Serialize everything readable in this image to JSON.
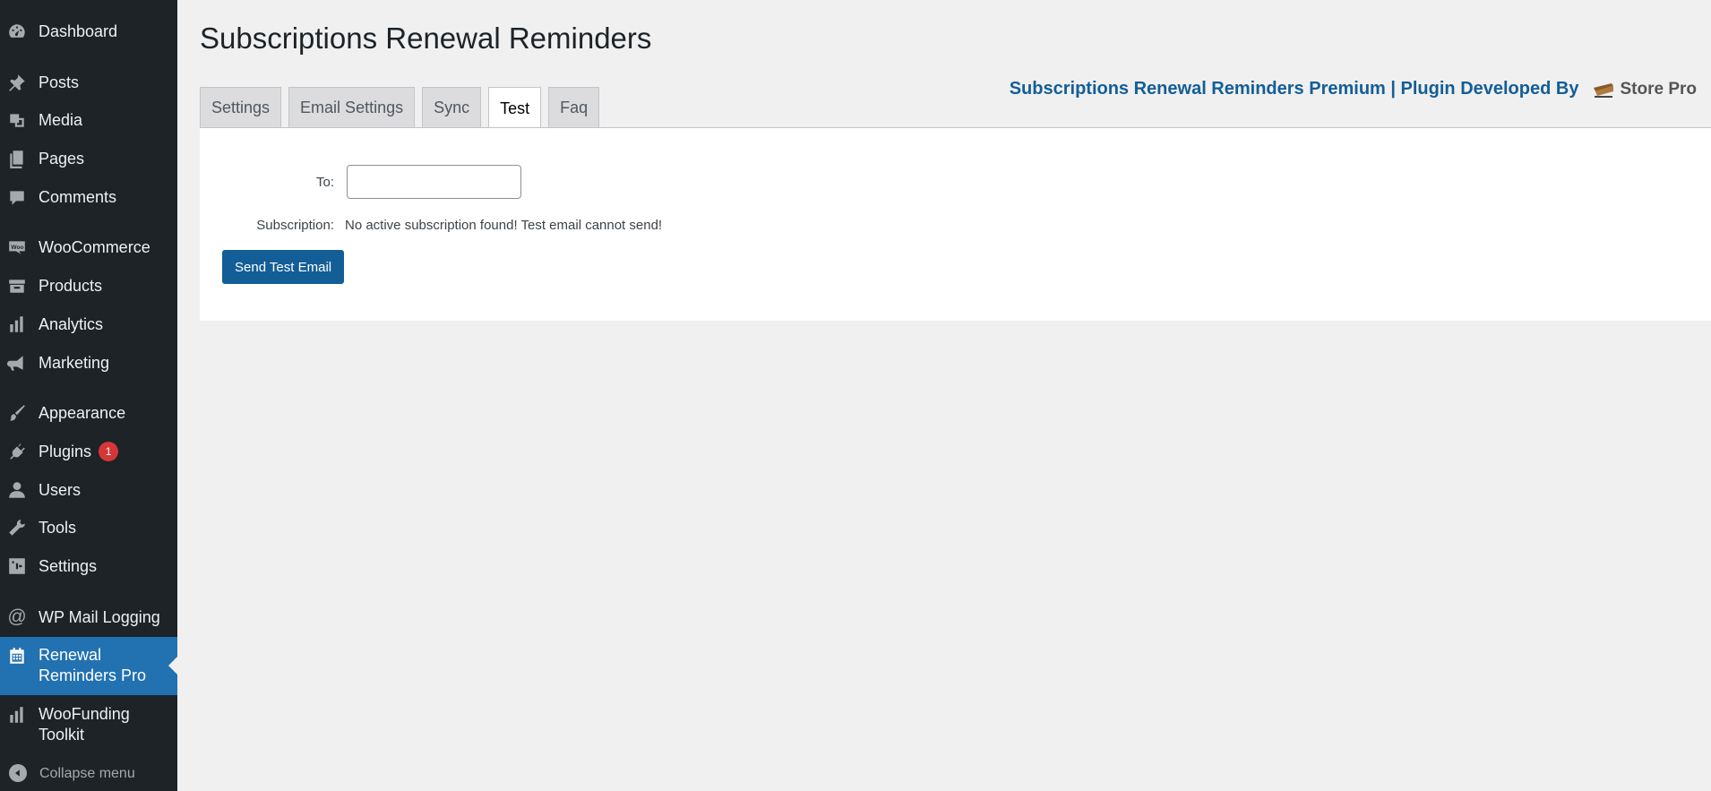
{
  "sidebar": {
    "items": [
      {
        "label": "Dashboard",
        "icon": "dashboard-icon"
      },
      {
        "label": "Posts",
        "icon": "pin-icon"
      },
      {
        "label": "Media",
        "icon": "media-icon"
      },
      {
        "label": "Pages",
        "icon": "pages-icon"
      },
      {
        "label": "Comments",
        "icon": "comments-icon"
      },
      {
        "label": "WooCommerce",
        "icon": "woocommerce-icon"
      },
      {
        "label": "Products",
        "icon": "archive-icon"
      },
      {
        "label": "Analytics",
        "icon": "bar-chart-icon"
      },
      {
        "label": "Marketing",
        "icon": "megaphone-icon"
      },
      {
        "label": "Appearance",
        "icon": "paintbrush-icon"
      },
      {
        "label": "Plugins",
        "icon": "plugin-icon",
        "badge": "1"
      },
      {
        "label": "Users",
        "icon": "user-icon"
      },
      {
        "label": "Tools",
        "icon": "wrench-icon"
      },
      {
        "label": "Settings",
        "icon": "settings-icon"
      },
      {
        "label": "WP Mail Logging",
        "icon": "at-icon"
      },
      {
        "label_line1": "Renewal",
        "label_line2": "Reminders Pro",
        "icon": "calendar-icon"
      },
      {
        "label_line1": "WooFunding",
        "label_line2": "Toolkit",
        "icon": "bar-chart-icon"
      }
    ],
    "collapse_label": "Collapse menu"
  },
  "page": {
    "title": "Subscriptions Renewal Reminders"
  },
  "tabs": [
    "Settings",
    "Email Settings",
    "Sync",
    "Test",
    "Faq"
  ],
  "active_tab": "Test",
  "promo": {
    "text": "Subscriptions Renewal Reminders Premium | Plugin Developed By",
    "logo_text": "Store Pro"
  },
  "form": {
    "to_label": "To:",
    "to_value": "",
    "subscription_label": "Subscription:",
    "subscription_message": "No active subscription found! Test email cannot send!",
    "send_button": "Send Test Email"
  },
  "colors": {
    "sidebar_bg": "#1d2327",
    "accent": "#2271b1",
    "button": "#135e96",
    "badge": "#d63638"
  }
}
